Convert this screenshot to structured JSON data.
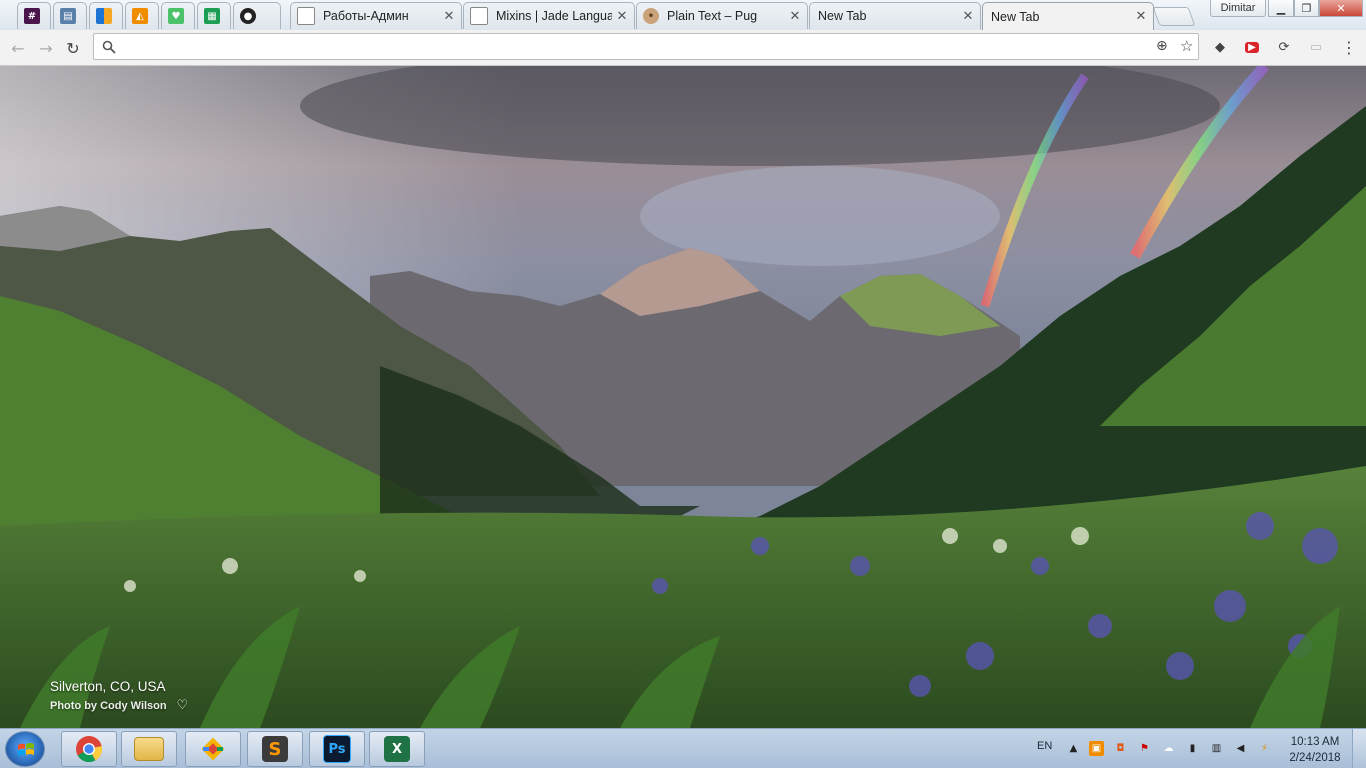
{
  "window": {
    "profile_name": "Dimitar",
    "minimize_icon": "minimize-icon",
    "restore_icon": "restore-icon",
    "close_icon": "close-icon"
  },
  "tabs": [
    {
      "title": "",
      "icon": "slack-icon",
      "color": "#4a154b"
    },
    {
      "title": "",
      "icon": "doc-icon",
      "color": "#5a7fa8"
    },
    {
      "title": "",
      "icon": "grid-icon",
      "color": "#f5a623"
    },
    {
      "title": "",
      "icon": "ladder-icon",
      "color": "#f08c00"
    },
    {
      "title": "",
      "icon": "hearts-icon",
      "color": "#4cc26b"
    },
    {
      "title": "",
      "icon": "sheets-icon",
      "color": "#1e9e54"
    },
    {
      "title": "",
      "icon": "github-icon",
      "color": "#222222"
    },
    {
      "title": "Работы-Админ",
      "icon": "page-icon",
      "color": "#ffffff"
    },
    {
      "title": "Mixins | Jade Language",
      "icon": "page-icon",
      "color": "#ffffff"
    },
    {
      "title": "Plain Text – Pug",
      "icon": "pug-icon",
      "color": "#c9a27a"
    },
    {
      "title": "New Tab",
      "icon": "blank-icon",
      "color": "#ffffff"
    },
    {
      "title": "New Tab",
      "icon": "blank-icon",
      "color": "#ffffff",
      "active": true
    }
  ],
  "toolbar": {
    "back_icon": "back-arrow-icon",
    "forward_icon": "forward-arrow-icon",
    "reload_icon": "reload-icon",
    "search_icon": "search-icon",
    "address_value": "",
    "location_icon": "location-target-icon",
    "bookmark_icon": "star-icon",
    "extensions": [
      "eraser-icon",
      "red-extension-icon",
      "sync-icon",
      "cast-icon"
    ],
    "menu_icon": "kebab-menu-icon"
  },
  "content": {
    "location": "Silverton, CO, USA",
    "photo_credit": "Photo by Cody Wilson",
    "heart_icon": "heart-icon"
  },
  "taskbar": {
    "start_icon": "windows-start-icon",
    "pinned": [
      {
        "name": "chrome",
        "icon": "chrome-icon"
      },
      {
        "name": "explorer",
        "icon": "folder-icon"
      },
      {
        "name": "git",
        "icon": "git-diamond-icon"
      },
      {
        "name": "sublime",
        "icon": "sublime-text-icon",
        "label": "S"
      },
      {
        "name": "photoshop",
        "icon": "photoshop-icon",
        "label": "Ps"
      },
      {
        "name": "excel",
        "icon": "excel-icon",
        "label": "X"
      }
    ],
    "language": "EN",
    "tray_icons": [
      "tray-up-arrow-icon",
      "tray-app1-icon",
      "tray-app2-icon",
      "tray-flag-icon",
      "tray-cloud-icon",
      "tray-usb-icon",
      "tray-network-icon",
      "tray-device-icon",
      "tray-volume-icon",
      "tray-power-icon"
    ],
    "time": "10:13 AM",
    "date": "2/24/2018"
  }
}
